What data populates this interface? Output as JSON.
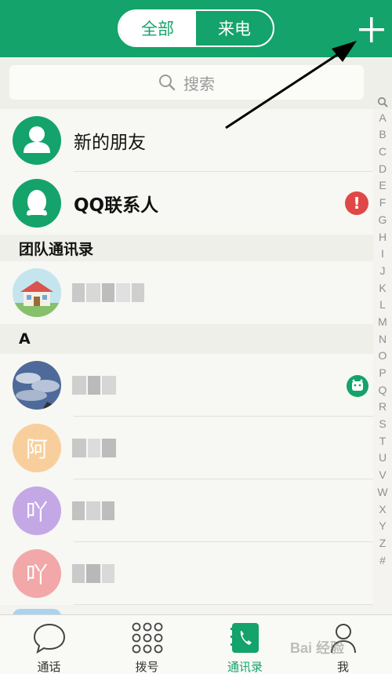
{
  "header": {
    "segments": [
      {
        "label": "全部",
        "active": true
      },
      {
        "label": "来电",
        "active": false
      }
    ],
    "add_icon": "plus-icon",
    "color": "#14a36a"
  },
  "search": {
    "placeholder": "搜索",
    "icon": "search-icon"
  },
  "top_items": [
    {
      "label": "新的朋友",
      "icon": "person-icon"
    },
    {
      "label": "QQ联系人",
      "icon": "qq-penguin-icon",
      "badge": "!"
    }
  ],
  "sections": [
    {
      "header": "团队通讯录"
    },
    {
      "header": "A"
    }
  ],
  "contacts": [
    {
      "avatar_text": "",
      "avatar_type": "house-photo"
    },
    {
      "avatar_text": "",
      "avatar_type": "sky-photo",
      "badge_icon": "pet-face-icon"
    },
    {
      "avatar_text": "阿",
      "avatar_color": "#f8cf9c"
    },
    {
      "avatar_text": "吖",
      "avatar_color": "#c4a8e6"
    },
    {
      "avatar_text": "吖",
      "avatar_color": "#f2a8a8"
    }
  ],
  "index_letters": [
    "A",
    "B",
    "C",
    "D",
    "E",
    "F",
    "G",
    "H",
    "I",
    "J",
    "K",
    "L",
    "M",
    "N",
    "O",
    "P",
    "Q",
    "R",
    "S",
    "T",
    "U",
    "V",
    "W",
    "X",
    "Y",
    "Z",
    "#"
  ],
  "tabbar": [
    {
      "label": "通话",
      "icon": "chat-bubble-icon",
      "active": false
    },
    {
      "label": "拨号",
      "icon": "dialpad-icon",
      "active": false
    },
    {
      "label": "通讯录",
      "icon": "address-book-icon",
      "active": true
    },
    {
      "label": "我",
      "icon": "profile-icon",
      "active": false
    }
  ],
  "watermark": "Bai 经验",
  "colors": {
    "accent": "#14a36a",
    "alert": "#e04848",
    "background": "#f4f3ef"
  }
}
